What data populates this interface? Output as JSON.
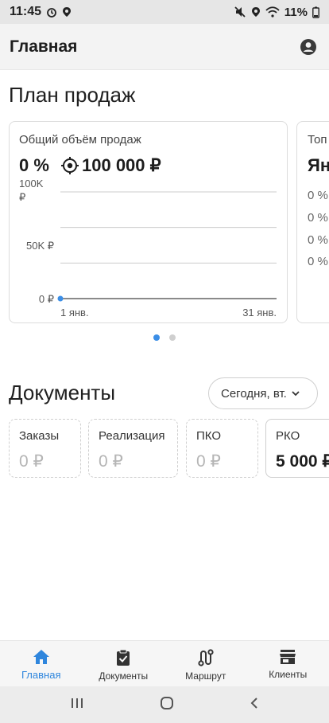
{
  "status_bar": {
    "time": "11:45",
    "battery": "11%",
    "icons": [
      "alarm-icon",
      "location-icon",
      "mute-icon",
      "wifi-icon",
      "battery-icon"
    ]
  },
  "app_bar": {
    "title": "Главная",
    "account_icon": "account-circle-icon"
  },
  "sales_plan": {
    "section_title": "План продаж",
    "card": {
      "title": "Общий объём продаж",
      "percent": "0 %",
      "target": "100 000 ₽",
      "target_icon": "crosshair-icon"
    },
    "next_card": {
      "title": "Топ",
      "big": "Ян",
      "rows": [
        "0 %",
        "0 %",
        "0 %",
        "0 %"
      ]
    },
    "pager": {
      "count": 2,
      "active": 0
    }
  },
  "chart_data": {
    "type": "line",
    "x_tick_labels": [
      "1 янв.",
      "31 янв."
    ],
    "y_tick_labels": [
      "0 ₽",
      "50K ₽",
      "100K ₽"
    ],
    "ylim": [
      0,
      100000
    ],
    "grid": true,
    "series": [
      {
        "values": [
          {
            "x": "1 янв.",
            "y": 0
          }
        ],
        "color": "#3b8ee6"
      }
    ]
  },
  "documents": {
    "section_title": "Документы",
    "date_filter": "Сегодня, вт.",
    "cards": [
      {
        "label": "Заказы",
        "value": "0 ₽",
        "style": "empty"
      },
      {
        "label": "Реализация",
        "value": "0 ₽",
        "style": "empty"
      },
      {
        "label": "ПКО",
        "value": "0 ₽",
        "style": "empty"
      },
      {
        "label": "РКО",
        "value": "5 000 ₽",
        "style": "filled"
      }
    ]
  },
  "bottom_nav": {
    "items": [
      {
        "label": "Главная",
        "icon": "home-icon",
        "active": true
      },
      {
        "label": "Документы",
        "icon": "clipboard-check-icon",
        "active": false
      },
      {
        "label": "Маршрут",
        "icon": "route-icon",
        "active": false
      },
      {
        "label": "Клиенты",
        "icon": "store-icon",
        "active": false
      }
    ]
  },
  "colors": {
    "accent": "#3b8ee6",
    "muted_text": "#b5b5b5",
    "app_bar_bg": "#f3f3f3"
  }
}
